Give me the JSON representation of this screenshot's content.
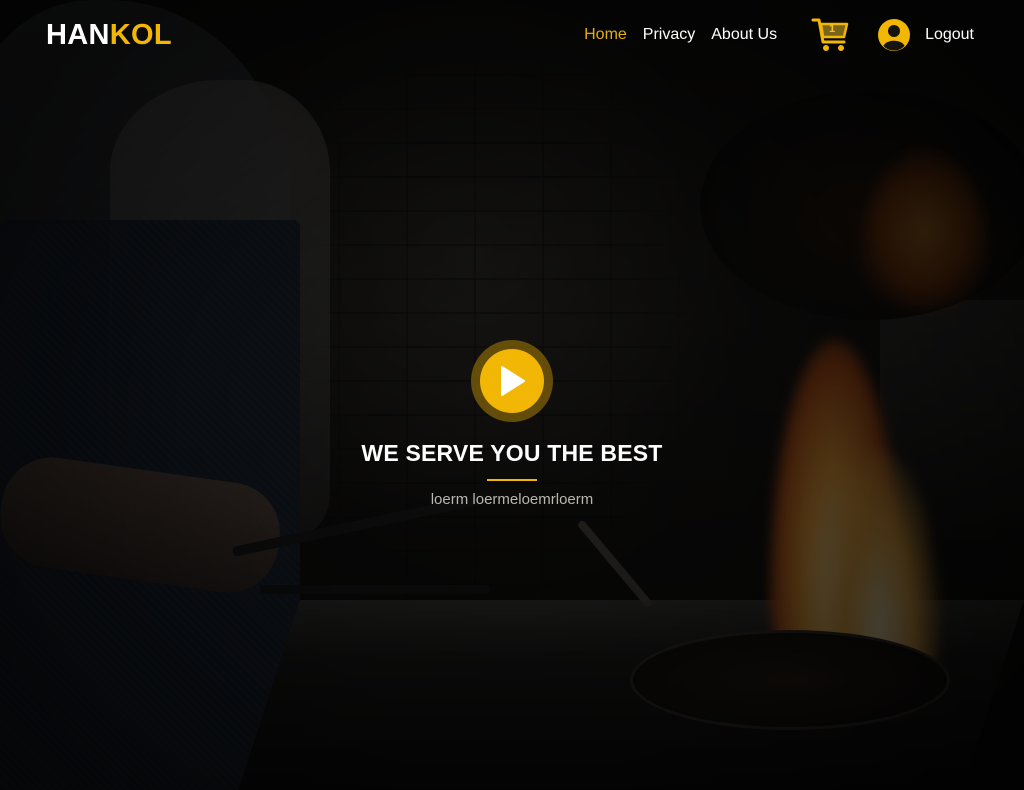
{
  "brand": {
    "part1": "HAN",
    "part2": "KOL"
  },
  "nav": {
    "links": [
      {
        "label": "Home",
        "active": true
      },
      {
        "label": "Privacy",
        "active": false
      },
      {
        "label": "About Us",
        "active": false
      }
    ],
    "cart": {
      "icon": "cart-icon",
      "count": "1"
    },
    "user": {
      "icon": "user-avatar-icon",
      "label": "Logout"
    }
  },
  "hero": {
    "play_icon": "play-icon",
    "title": "WE SERVE YOU THE BEST",
    "subtitle": "loerm loermeloemrloerm"
  },
  "colors": {
    "accent": "#f2b705",
    "active_link": "#e6ad0e",
    "text": "#ffffff",
    "subtitle": "#b9b6b0"
  }
}
